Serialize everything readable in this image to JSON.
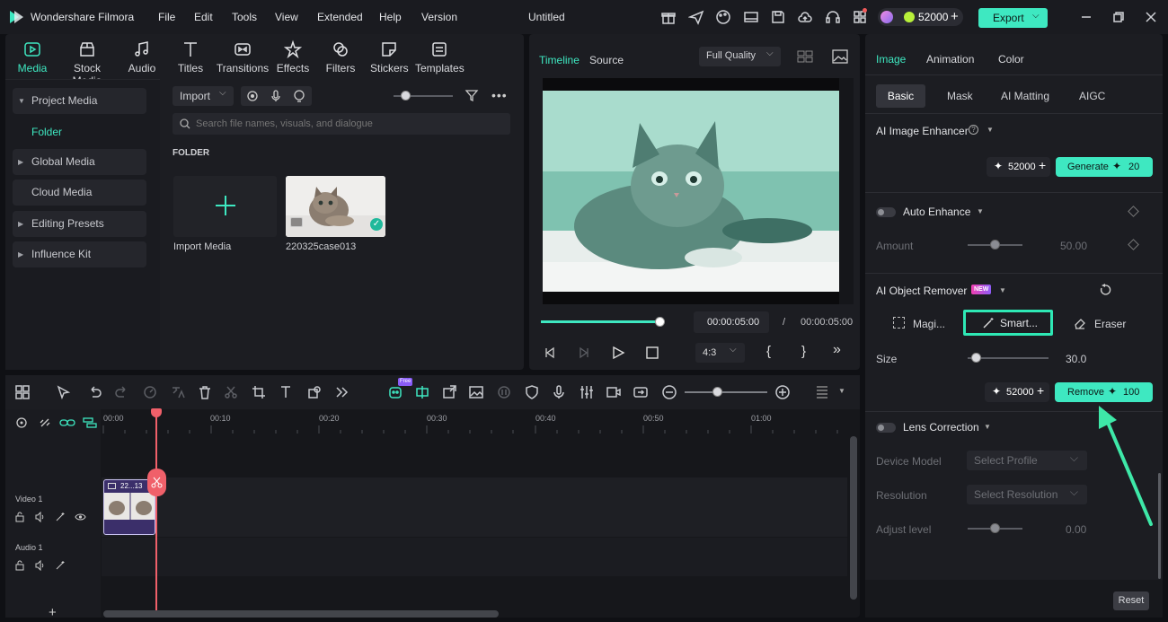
{
  "app": {
    "name": "Wondershare Filmora",
    "doc_title": "Untitled"
  },
  "menu": [
    "File",
    "Edit",
    "Tools",
    "View",
    "Extended",
    "Help",
    "Version"
  ],
  "credits": "52000",
  "export_label": "Export",
  "media_tools": [
    "Media",
    "Stock Media",
    "Audio",
    "Titles",
    "Transitions",
    "Effects",
    "Filters",
    "Stickers",
    "Templates"
  ],
  "sidebar": {
    "project_media": "Project Media",
    "folder": "Folder",
    "global_media": "Global Media",
    "cloud_media": "Cloud Media",
    "editing_presets": "Editing Presets",
    "influence_kit": "Influence Kit"
  },
  "media": {
    "import_label": "Import",
    "search_placeholder": "Search file names, visuals, and dialogue",
    "folder_heading": "FOLDER",
    "import_media_label": "Import Media",
    "clip_name": "220325case013"
  },
  "preview": {
    "tab_timeline": "Timeline",
    "tab_source": "Source",
    "quality": "Full Quality",
    "current_time": "00:00:05:00",
    "separator": "/",
    "total_time": "00:00:05:00",
    "aspect": "4:3",
    "progress": 1.0
  },
  "right": {
    "tabs": [
      "Image",
      "Animation",
      "Color"
    ],
    "subtabs": [
      "Basic",
      "Mask",
      "AI Matting",
      "AIGC"
    ],
    "enhancer_title": "AI Image Enhancer",
    "enhancer_credits": "52000",
    "generate_label": "Generate",
    "generate_cost": "20",
    "auto_enhance": "Auto Enhance",
    "amount_label": "Amount",
    "amount_value": "50.00",
    "amount_level": 0.5,
    "object_remover": "AI Object Remover",
    "new_badge": "NEW",
    "modes": [
      "Magi...",
      "Smart...",
      "Eraser"
    ],
    "size_label": "Size",
    "size_value": "30.0",
    "size_level": 0.15,
    "remove_credits": "52000",
    "remove_label": "Remove",
    "remove_cost": "100",
    "lens_correction": "Lens Correction",
    "device_model": "Device Model",
    "device_placeholder": "Select Profile",
    "resolution": "Resolution",
    "resolution_placeholder": "Select Resolution",
    "adjust_level": "Adjust level",
    "adjust_value": "0.00",
    "reset_label": "Reset"
  },
  "timeline": {
    "ruler": [
      "00:00",
      "00:10",
      "00:20",
      "00:30",
      "00:40",
      "00:50",
      "01:00"
    ],
    "video_track": "Video 1",
    "audio_track": "Audio 1",
    "clip_label": "22...13",
    "free_badge": "Free"
  },
  "colors": {
    "accent": "#3ee8c1",
    "bg": "#0f1014",
    "panel": "#1c1d22",
    "playhead": "#f0606a",
    "arrow": "#3ee8a8"
  }
}
